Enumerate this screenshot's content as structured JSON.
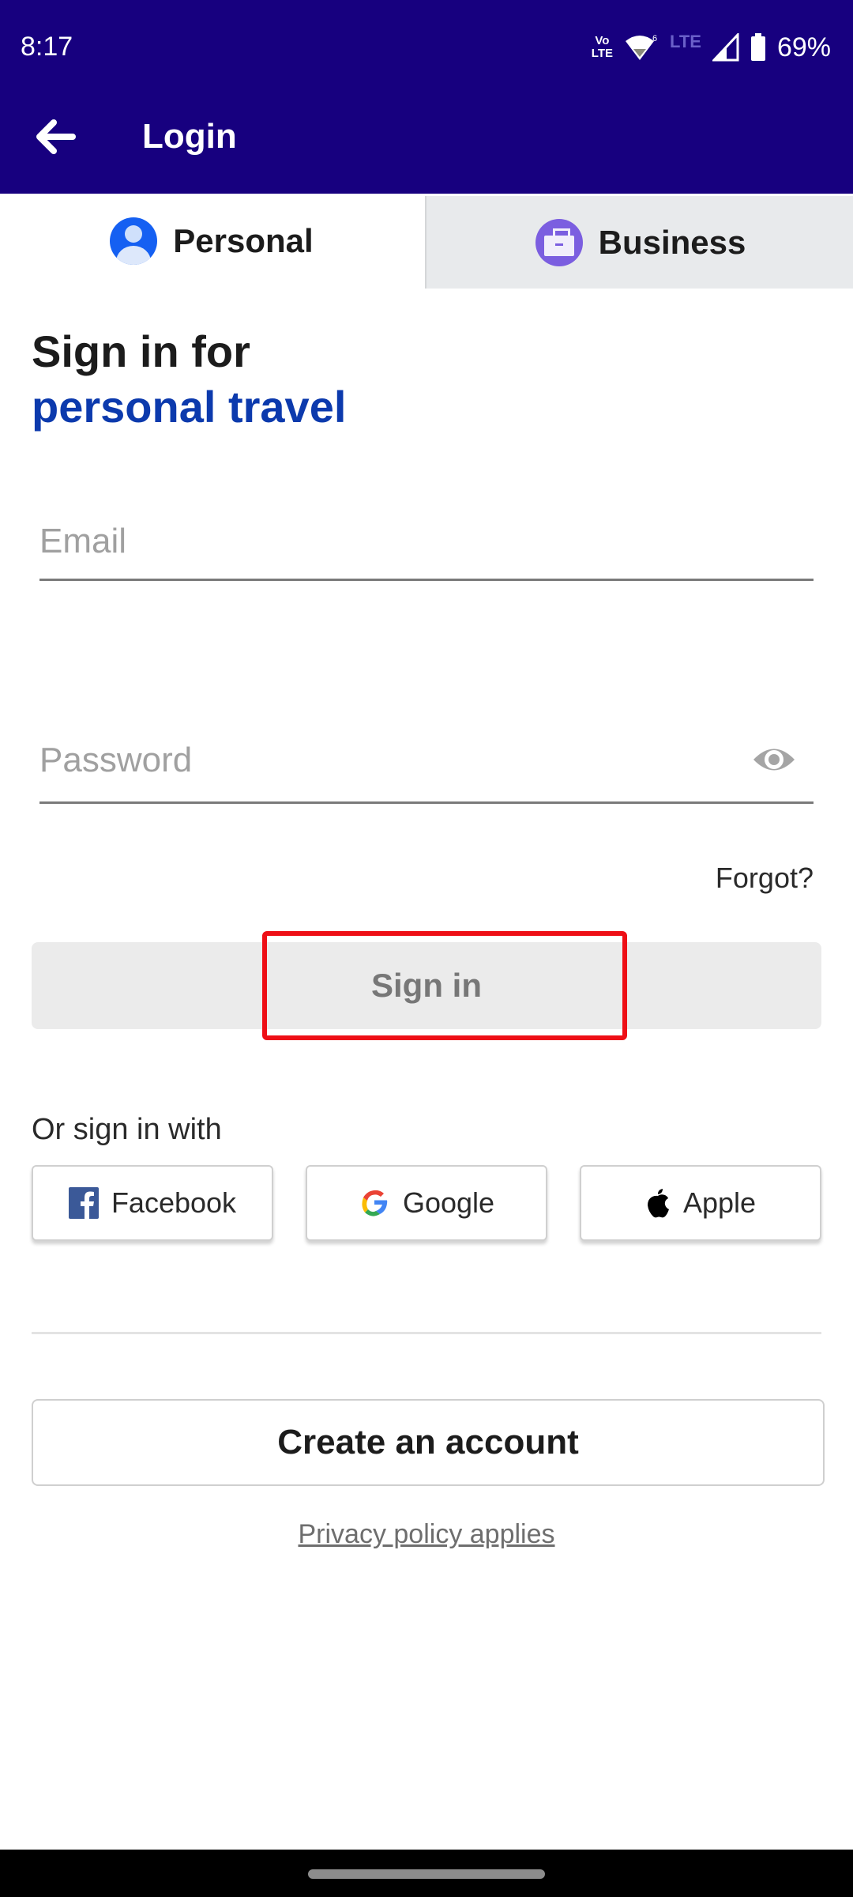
{
  "status_bar": {
    "time": "8:17",
    "volte_top": "Vo",
    "volte_bottom": "LTE",
    "wifi_badge": "6",
    "network_type": "LTE",
    "battery_percent": "69%",
    "icons": [
      "volte-icon",
      "wifi-icon",
      "lte-icon",
      "signal-icon",
      "battery-icon"
    ]
  },
  "app_bar": {
    "back_icon": "arrow-left-icon",
    "title": "Login",
    "background_color": "#17007f"
  },
  "tabs": [
    {
      "label": "Personal",
      "icon": "person-icon",
      "selected": true,
      "icon_color": "#1560f2"
    },
    {
      "label": "Business",
      "icon": "briefcase-icon",
      "selected": false,
      "icon_color": "#7b5ee0"
    }
  ],
  "heading": {
    "line1": "Sign in for",
    "line2": "personal travel",
    "accent_color": "#0c3aad"
  },
  "form": {
    "email": {
      "value": "",
      "placeholder": "Email"
    },
    "password": {
      "value": "",
      "placeholder": "Password",
      "toggle_icon": "eye-icon"
    },
    "forgot_label": "Forgot?",
    "sign_in_label": "Sign in",
    "sign_in_enabled": false
  },
  "social": {
    "label": "Or sign in with",
    "buttons": [
      {
        "label": "Facebook",
        "icon": "facebook-icon"
      },
      {
        "label": "Google",
        "icon": "google-icon"
      },
      {
        "label": "Apple",
        "icon": "apple-icon"
      }
    ]
  },
  "create_account_label": "Create an account",
  "privacy_label": "Privacy policy applies",
  "annotation": {
    "highlight_target": "sign-in-button",
    "color": "#ee0f16"
  }
}
